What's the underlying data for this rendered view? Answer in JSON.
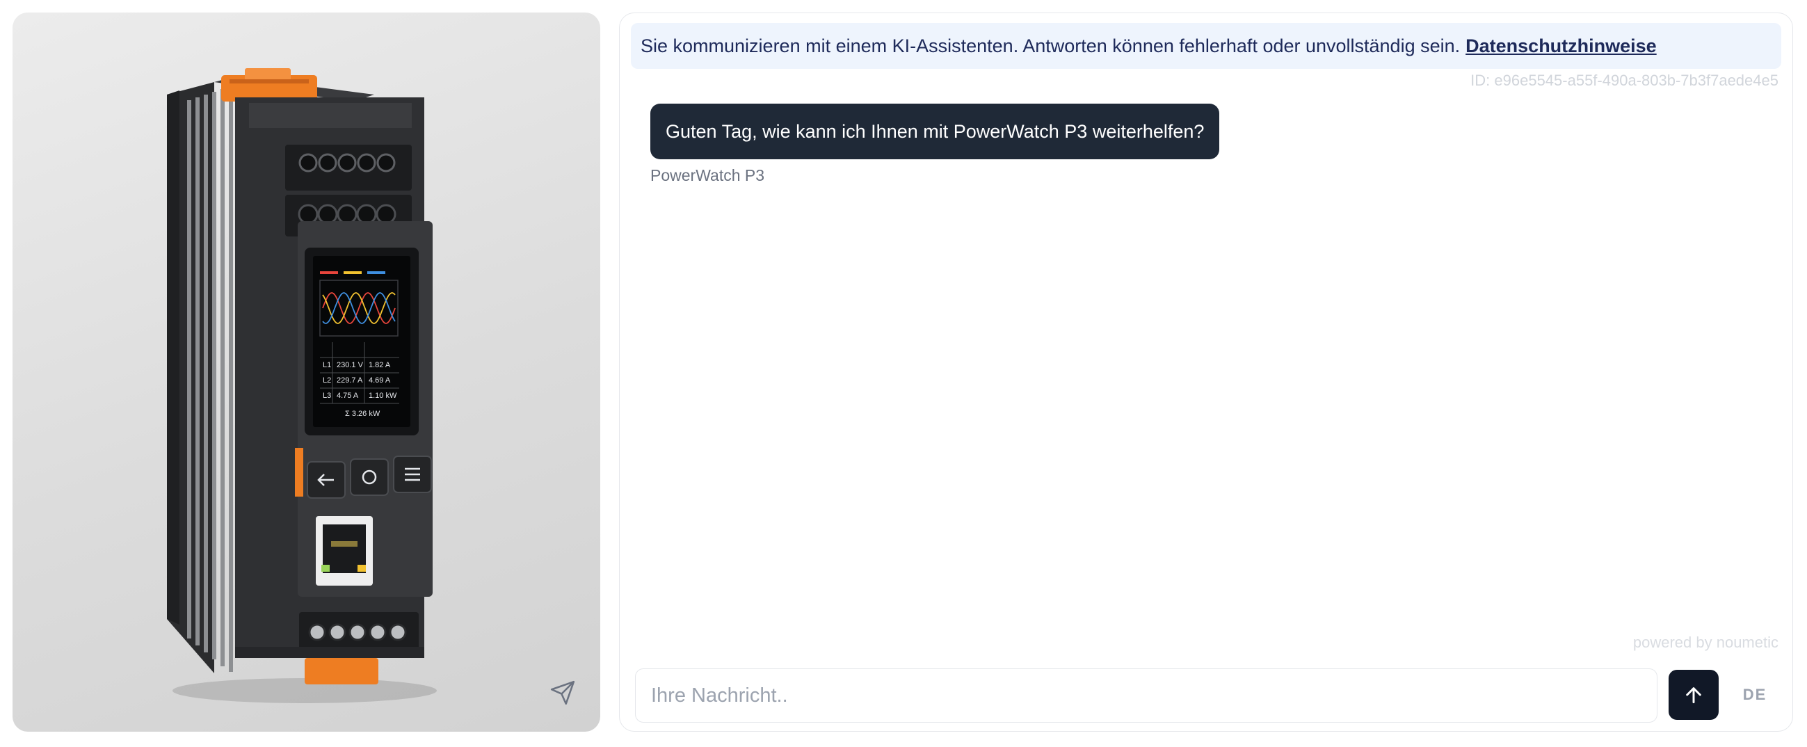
{
  "product": {
    "display": {
      "rows": [
        {
          "phase": "L1",
          "voltage": "230.1 V",
          "power": "1.82 A"
        },
        {
          "phase": "L2",
          "voltage": "229.7 A",
          "power": "4.69 A"
        },
        {
          "phase": "L3",
          "voltage": "4.75 A",
          "power": "1.10 kW"
        }
      ],
      "total": "Σ 3.26 kW",
      "wave_colors": [
        "#e8453c",
        "#f2c230",
        "#3f8fe0"
      ]
    },
    "accent_color": "#f07a1e",
    "share_icon": "send-icon"
  },
  "chat": {
    "notice": {
      "text": "Sie kommunizieren mit einem KI-Assistenten. Antworten können fehlerhaft oder unvollständig sein.",
      "link": "Datenschutzhinweise"
    },
    "session_id": "ID: e96e5545-a55f-490a-803b-7b3f7aede4e5",
    "messages": [
      {
        "text": "Guten Tag, wie kann ich Ihnen mit PowerWatch P3 weiterhelfen?",
        "sender": "PowerWatch P3"
      }
    ],
    "powered_by": "powered by noumetic",
    "input": {
      "placeholder": "Ihre Nachricht..",
      "value": ""
    },
    "send_icon": "arrow-up-icon",
    "language": "DE"
  }
}
